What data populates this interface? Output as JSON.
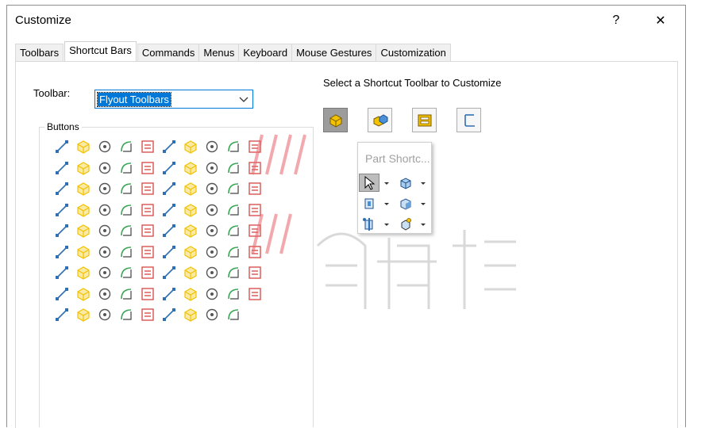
{
  "window": {
    "title": "Customize",
    "help_glyph": "?",
    "close_glyph": "✕"
  },
  "tabs": [
    {
      "label": "Toolbars",
      "active": false
    },
    {
      "label": "Shortcut Bars",
      "active": true
    },
    {
      "label": "Commands",
      "active": false
    },
    {
      "label": "Menus",
      "active": false
    },
    {
      "label": "Keyboard",
      "active": false
    },
    {
      "label": "Mouse Gestures",
      "active": false
    },
    {
      "label": "Customization",
      "active": false
    }
  ],
  "toolbar_field": {
    "label": "Toolbar:",
    "value": "Flyout Toolbars"
  },
  "buttons_group": {
    "legend": "Buttons",
    "rows": [
      [
        "rebuild-icon",
        "left-align-icon",
        "text-style-icon",
        "part-icon",
        "note-icon",
        "spline-icon",
        "datum-icon",
        "crosshair-icon",
        "toolbox-icon",
        "feature-palette-icon"
      ],
      [
        "surface-icon",
        "dimxpert-icon",
        "sketch-plane-icon",
        "hatch-icon",
        "3d-view-icon",
        "photo-icon",
        "hole-icon",
        "bookmark-icon",
        "appearance-icon",
        "render-icon"
      ],
      [
        "filter-icon",
        "drawing-view-icon",
        "model-views-icon",
        "layers-icon",
        "fillet-icon",
        "pencil-icon",
        "sw-logo-icon",
        "curve-icon",
        "save-icon",
        "rotate-box-icon"
      ],
      [
        "measure-icon",
        "undo-icon",
        "table-icon",
        "toolkit-icon",
        "zoom-icon",
        "globe-icon",
        "import-icon",
        "document-icon",
        "export-icon",
        "save-disk-icon"
      ],
      [
        "print-icon",
        "settings-icon",
        "corner-icon",
        "line-icon",
        "rectangle-icon",
        "slot-icon",
        "circle-icon",
        "arc-icon",
        "ellipse-icon",
        "spline-2-icon"
      ],
      [
        "corner-arc-icon",
        "box-icon",
        "assembly-icon",
        "mate-icon",
        "rebuild-assembly-icon",
        "view-icon",
        "flip-icon",
        "triple-icon",
        "monitor-icon",
        "check-icon"
      ],
      [
        "probe-icon",
        "weld-icon",
        "pattern-icon",
        "cube-icon",
        "component-icon",
        "dimension-icon",
        "pen-icon",
        "markup-icon",
        "ruler-icon",
        "section-icon"
      ],
      [
        "linear-icon",
        "bom-icon",
        "arrows-icon",
        "list-icon",
        "design-library-icon",
        "chart-icon",
        "color-icon",
        "structure-icon",
        "probe-2-icon",
        "gear-icon"
      ],
      [
        "align-icon",
        "spring-icon",
        "cube-color-icon",
        "mixed-icon",
        "shaded-icon",
        "display-style-icon",
        "target-icon",
        "gallery-icon",
        "analysis-icon"
      ]
    ]
  },
  "shortcut_section": {
    "label": "Select a Shortcut Toolbar to Customize",
    "buttons": [
      "part-shortcut-icon",
      "assembly-shortcut-icon",
      "drawing-shortcut-icon",
      "sketch-shortcut-icon"
    ]
  },
  "flyout": {
    "title": "Part Shortc...",
    "items": [
      "select-pointer-icon",
      "rotate-view-icon",
      "front-view-icon",
      "iso-view-icon",
      "section-view-icon",
      "zoom-fit-icon"
    ]
  },
  "colors": {
    "accent": "#0078d7",
    "selected_bg": "#9c9c9c",
    "icon_blue": "#2f6fb3",
    "icon_yellow": "#f2c200",
    "watermark": "#c0c0c0",
    "watermark_red": "#e8646c"
  }
}
